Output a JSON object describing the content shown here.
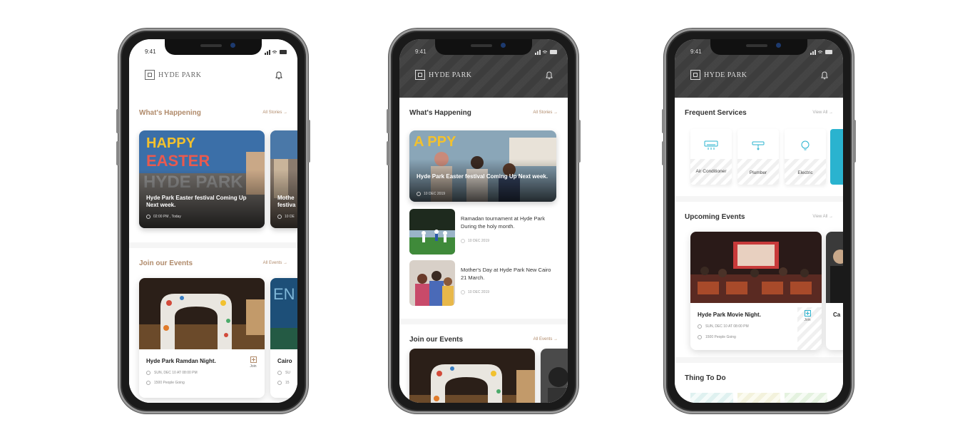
{
  "status_time": "9:41",
  "brand": {
    "name": "HYDE PARK"
  },
  "icons": {
    "bell": "bell-icon",
    "clock": "clock-icon",
    "people": "people-icon",
    "join": "plus-square-icon",
    "logo": "hyde-park-logo-icon",
    "air": "air-conditioner-icon",
    "plumber": "plumber-icon",
    "electric": "lightbulb-icon"
  },
  "colors": {
    "accent_brown": "#b08a6a",
    "accent_teal": "#2ab3cf",
    "dark_header": "#3d3d3d"
  },
  "phone1": {
    "happening": {
      "title": "What's Happening",
      "link": "All Stories →",
      "card1": {
        "text": "Hyde Park Easter festival Coming Up Next week.",
        "meta": "02:00 PM , Today"
      },
      "card2": {
        "text": "Mothe festiva",
        "meta": "10 DE"
      }
    },
    "events": {
      "title": "Join our Events",
      "link": "All Events →",
      "card1": {
        "title": "Hyde Park Ramdan Night.",
        "date": "SUN, DEC 10 AT 08:00 PM",
        "going": "1500 People Going",
        "join": "Join"
      },
      "card2": {
        "title": "Cairo",
        "date": "SU",
        "going": "15"
      }
    }
  },
  "phone2": {
    "happening": {
      "title": "What's Happening",
      "link": "All Stories →",
      "card": {
        "text": "Hyde Park Easter festival Coming Up Next week.",
        "meta": "10 DEC 2019"
      }
    },
    "list": [
      {
        "text": "Ramadan tournament  at Hyde Park During the holy month.",
        "meta": "10 DEC 2019"
      },
      {
        "text": "Mother's Day at Hyde Park New Cairo 21 March.",
        "meta": "10 DEC 2019"
      }
    ],
    "events": {
      "title": "Join our Events",
      "link": "All Events →"
    }
  },
  "phone3": {
    "services": {
      "title": "Frequent Services",
      "link": "View All →",
      "items": [
        {
          "label": "Air Conditioner"
        },
        {
          "label": "Plumber"
        },
        {
          "label": "Electric"
        }
      ]
    },
    "upcoming": {
      "title": "Upcoming Events",
      "link": "View All →",
      "card": {
        "title": "Hyde Park Movie Night.",
        "date": "SUN, DEC 10 AT 08:00 PM",
        "going": "1500 People Going",
        "join": "Join"
      },
      "card2": {
        "title": "Ca"
      }
    },
    "things": {
      "title": "Thing To Do"
    }
  }
}
